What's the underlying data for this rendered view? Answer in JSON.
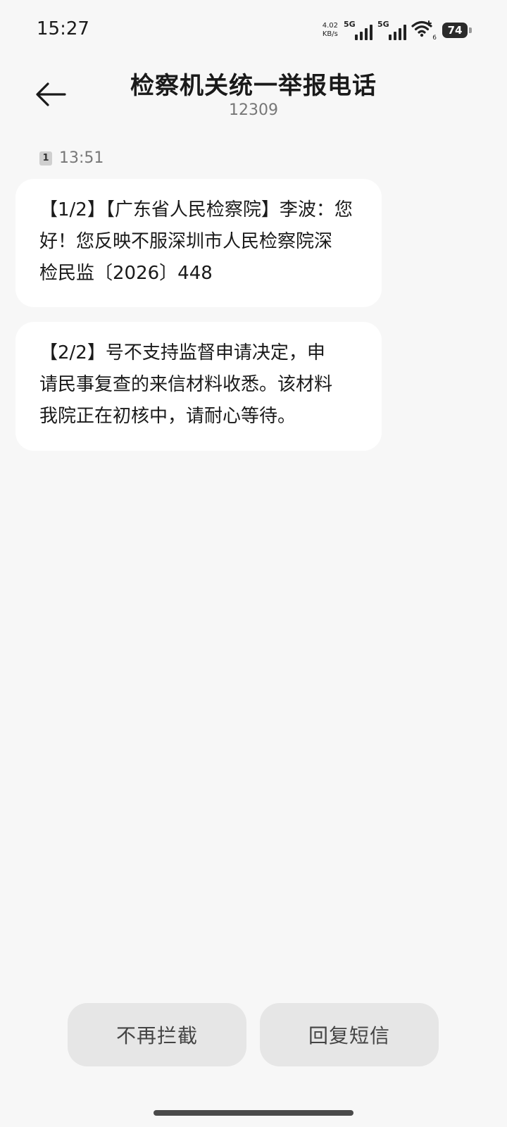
{
  "status_bar": {
    "time": "15:27",
    "net_speed_value": "4.02",
    "net_speed_unit": "KB/s",
    "sim1_network": "5G",
    "sim2_network": "5G",
    "wifi_number": "6",
    "battery": "74"
  },
  "header": {
    "title": "检察机关统一举报电话",
    "number": "12309"
  },
  "conversation": {
    "sim_slot": "1",
    "time": "13:51",
    "messages": [
      {
        "lines": [
          "【1/2】【广东省人民检察院】李波：您",
          "好！您反映不服深圳市人民检察院深",
          "检民监〔2026〕448"
        ]
      },
      {
        "lines": [
          "【2/2】号不支持监督申请决定，申",
          "请民事复查的来信材料收悉。该材料",
          "我院正在初核中，请耐心等待。"
        ]
      }
    ]
  },
  "actions": {
    "unblock_label": "不再拦截",
    "reply_label": "回复短信"
  }
}
